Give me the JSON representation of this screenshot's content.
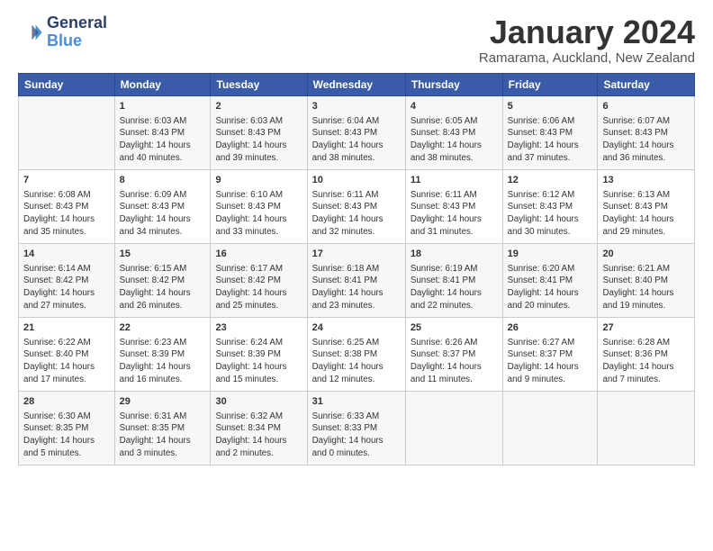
{
  "header": {
    "logo_line1": "General",
    "logo_line2": "Blue",
    "month": "January 2024",
    "location": "Ramarama, Auckland, New Zealand"
  },
  "days_of_week": [
    "Sunday",
    "Monday",
    "Tuesday",
    "Wednesday",
    "Thursday",
    "Friday",
    "Saturday"
  ],
  "weeks": [
    [
      {
        "day": "",
        "content": ""
      },
      {
        "day": "1",
        "content": "Sunrise: 6:03 AM\nSunset: 8:43 PM\nDaylight: 14 hours\nand 40 minutes."
      },
      {
        "day": "2",
        "content": "Sunrise: 6:03 AM\nSunset: 8:43 PM\nDaylight: 14 hours\nand 39 minutes."
      },
      {
        "day": "3",
        "content": "Sunrise: 6:04 AM\nSunset: 8:43 PM\nDaylight: 14 hours\nand 38 minutes."
      },
      {
        "day": "4",
        "content": "Sunrise: 6:05 AM\nSunset: 8:43 PM\nDaylight: 14 hours\nand 38 minutes."
      },
      {
        "day": "5",
        "content": "Sunrise: 6:06 AM\nSunset: 8:43 PM\nDaylight: 14 hours\nand 37 minutes."
      },
      {
        "day": "6",
        "content": "Sunrise: 6:07 AM\nSunset: 8:43 PM\nDaylight: 14 hours\nand 36 minutes."
      }
    ],
    [
      {
        "day": "7",
        "content": "Sunrise: 6:08 AM\nSunset: 8:43 PM\nDaylight: 14 hours\nand 35 minutes."
      },
      {
        "day": "8",
        "content": "Sunrise: 6:09 AM\nSunset: 8:43 PM\nDaylight: 14 hours\nand 34 minutes."
      },
      {
        "day": "9",
        "content": "Sunrise: 6:10 AM\nSunset: 8:43 PM\nDaylight: 14 hours\nand 33 minutes."
      },
      {
        "day": "10",
        "content": "Sunrise: 6:11 AM\nSunset: 8:43 PM\nDaylight: 14 hours\nand 32 minutes."
      },
      {
        "day": "11",
        "content": "Sunrise: 6:11 AM\nSunset: 8:43 PM\nDaylight: 14 hours\nand 31 minutes."
      },
      {
        "day": "12",
        "content": "Sunrise: 6:12 AM\nSunset: 8:43 PM\nDaylight: 14 hours\nand 30 minutes."
      },
      {
        "day": "13",
        "content": "Sunrise: 6:13 AM\nSunset: 8:43 PM\nDaylight: 14 hours\nand 29 minutes."
      }
    ],
    [
      {
        "day": "14",
        "content": "Sunrise: 6:14 AM\nSunset: 8:42 PM\nDaylight: 14 hours\nand 27 minutes."
      },
      {
        "day": "15",
        "content": "Sunrise: 6:15 AM\nSunset: 8:42 PM\nDaylight: 14 hours\nand 26 minutes."
      },
      {
        "day": "16",
        "content": "Sunrise: 6:17 AM\nSunset: 8:42 PM\nDaylight: 14 hours\nand 25 minutes."
      },
      {
        "day": "17",
        "content": "Sunrise: 6:18 AM\nSunset: 8:41 PM\nDaylight: 14 hours\nand 23 minutes."
      },
      {
        "day": "18",
        "content": "Sunrise: 6:19 AM\nSunset: 8:41 PM\nDaylight: 14 hours\nand 22 minutes."
      },
      {
        "day": "19",
        "content": "Sunrise: 6:20 AM\nSunset: 8:41 PM\nDaylight: 14 hours\nand 20 minutes."
      },
      {
        "day": "20",
        "content": "Sunrise: 6:21 AM\nSunset: 8:40 PM\nDaylight: 14 hours\nand 19 minutes."
      }
    ],
    [
      {
        "day": "21",
        "content": "Sunrise: 6:22 AM\nSunset: 8:40 PM\nDaylight: 14 hours\nand 17 minutes."
      },
      {
        "day": "22",
        "content": "Sunrise: 6:23 AM\nSunset: 8:39 PM\nDaylight: 14 hours\nand 16 minutes."
      },
      {
        "day": "23",
        "content": "Sunrise: 6:24 AM\nSunset: 8:39 PM\nDaylight: 14 hours\nand 15 minutes."
      },
      {
        "day": "24",
        "content": "Sunrise: 6:25 AM\nSunset: 8:38 PM\nDaylight: 14 hours\nand 12 minutes."
      },
      {
        "day": "25",
        "content": "Sunrise: 6:26 AM\nSunset: 8:37 PM\nDaylight: 14 hours\nand 11 minutes."
      },
      {
        "day": "26",
        "content": "Sunrise: 6:27 AM\nSunset: 8:37 PM\nDaylight: 14 hours\nand 9 minutes."
      },
      {
        "day": "27",
        "content": "Sunrise: 6:28 AM\nSunset: 8:36 PM\nDaylight: 14 hours\nand 7 minutes."
      }
    ],
    [
      {
        "day": "28",
        "content": "Sunrise: 6:30 AM\nSunset: 8:35 PM\nDaylight: 14 hours\nand 5 minutes."
      },
      {
        "day": "29",
        "content": "Sunrise: 6:31 AM\nSunset: 8:35 PM\nDaylight: 14 hours\nand 3 minutes."
      },
      {
        "day": "30",
        "content": "Sunrise: 6:32 AM\nSunset: 8:34 PM\nDaylight: 14 hours\nand 2 minutes."
      },
      {
        "day": "31",
        "content": "Sunrise: 6:33 AM\nSunset: 8:33 PM\nDaylight: 14 hours\nand 0 minutes."
      },
      {
        "day": "",
        "content": ""
      },
      {
        "day": "",
        "content": ""
      },
      {
        "day": "",
        "content": ""
      }
    ]
  ]
}
